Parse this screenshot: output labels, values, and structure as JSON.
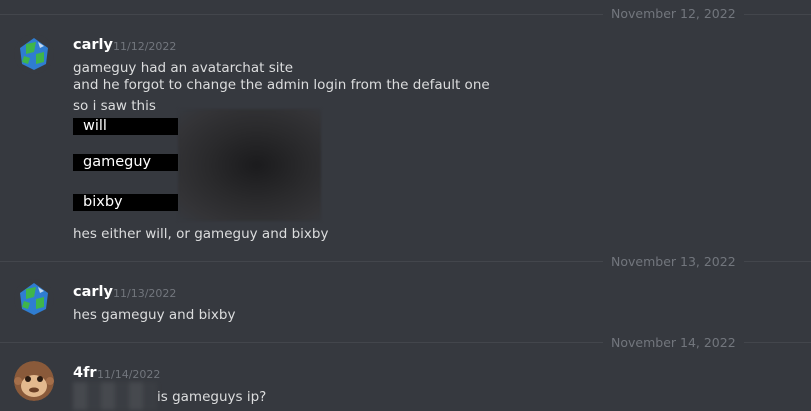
{
  "dividers": [
    {
      "date": "November 12, 2022"
    },
    {
      "date": "November 13, 2022"
    },
    {
      "date": "November 14, 2022"
    }
  ],
  "messages": [
    {
      "author": "carly",
      "timestamp": "11/12/2022",
      "lines": [
        "gameguy had an avatarchat site",
        "and he forgot to change the admin login from the default one",
        "so i saw this"
      ],
      "image_labels": [
        "will",
        "gameguy",
        "bixby"
      ],
      "after": "hes either will, or gameguy and bixby"
    },
    {
      "author": "carly",
      "timestamp": "11/13/2022",
      "lines": [
        "hes gameguy and bixby"
      ]
    },
    {
      "author": "4fr",
      "timestamp": "11/14/2022",
      "lines": [
        "is gameguys ip?"
      ]
    }
  ],
  "colors": {
    "background": "#36393f",
    "text": "#dcddde",
    "muted": "#72767d",
    "username": "#ffffff"
  },
  "icons": {
    "avatar_carly": "globe-avatar",
    "avatar_4fr": "monkey-avatar"
  }
}
